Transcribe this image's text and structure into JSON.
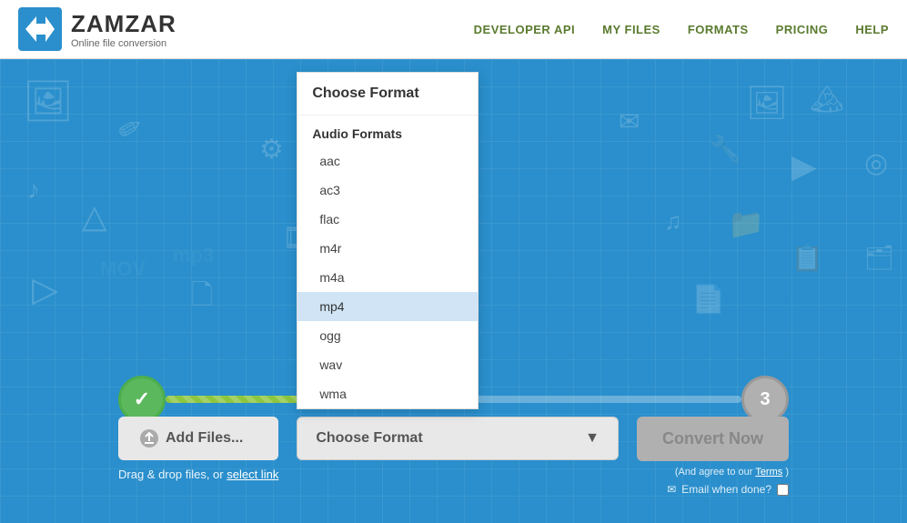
{
  "header": {
    "logo_name": "ZAMZAR",
    "logo_tagline": "Online file conversion",
    "nav": [
      {
        "label": "DEVELOPER API",
        "id": "developer-api"
      },
      {
        "label": "MY FILES",
        "id": "my-files"
      },
      {
        "label": "FORMATS",
        "id": "formats"
      },
      {
        "label": "PRICING",
        "id": "pricing"
      },
      {
        "label": "HELP",
        "id": "help"
      }
    ]
  },
  "steps": {
    "step1_done": "✓",
    "step3_number": "3"
  },
  "actions": {
    "add_files_label": "Add Files...",
    "drag_drop_text": "Drag & drop files, or",
    "select_link_text": "select link",
    "choose_format_label": "Choose Format",
    "convert_now_label": "Convert Now",
    "agree_text": "(And agree to our",
    "agree_link": "Terms",
    "agree_end": ")",
    "email_label": "Email when done?"
  },
  "dropdown": {
    "header": "Choose Format",
    "categories": [
      {
        "name": "Audio Formats",
        "items": [
          {
            "value": "aac",
            "label": "aac",
            "selected": false
          },
          {
            "value": "ac3",
            "label": "ac3",
            "selected": false
          },
          {
            "value": "flac",
            "label": "flac",
            "selected": false
          },
          {
            "value": "m4r",
            "label": "m4r",
            "selected": false
          },
          {
            "value": "m4a",
            "label": "m4a",
            "selected": false
          },
          {
            "value": "mp4",
            "label": "mp4",
            "selected": true
          },
          {
            "value": "ogg",
            "label": "ogg",
            "selected": false
          },
          {
            "value": "wav",
            "label": "wav",
            "selected": false
          },
          {
            "value": "wma",
            "label": "wma",
            "selected": false
          }
        ]
      }
    ]
  },
  "colors": {
    "bg_blue": "#2a8fcc",
    "green_done": "#5cb85c",
    "step_pending": "#b0b0b0",
    "nav_green": "#5a7a2e"
  }
}
